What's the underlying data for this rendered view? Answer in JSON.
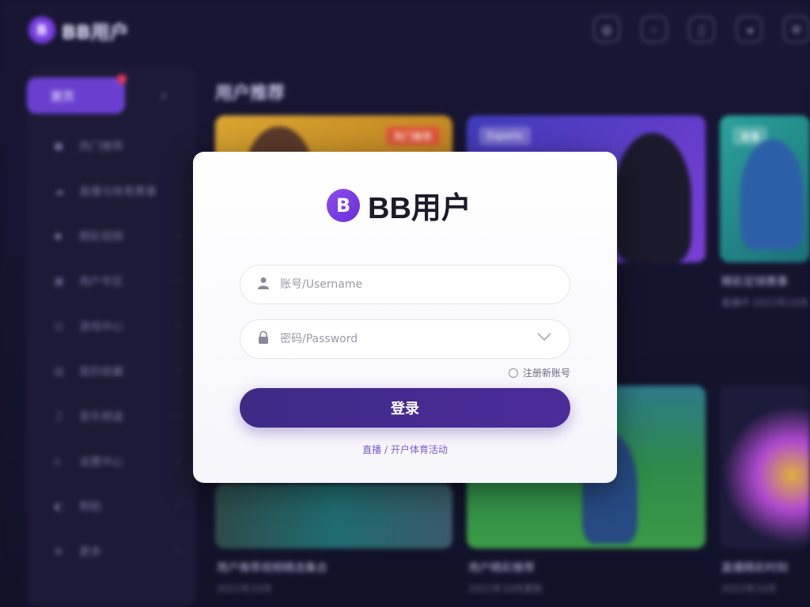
{
  "header": {
    "logo_letter": "B",
    "brand": "BB用户",
    "icons": [
      "globe-icon",
      "search-icon",
      "phone-icon",
      "bell-icon",
      "settings-icon"
    ]
  },
  "sidebar": {
    "active_label": "首页",
    "items": [
      {
        "icon": "●",
        "label": "热门推荐"
      },
      {
        "icon": "☁",
        "label": "直播与体育赛事"
      },
      {
        "icon": "◆",
        "label": "精彩视频"
      },
      {
        "icon": "▣",
        "label": "用户专区"
      },
      {
        "icon": "◎",
        "label": "游戏中心"
      },
      {
        "icon": "▤",
        "label": "我的收藏"
      },
      {
        "icon": "♫",
        "label": "音乐频道"
      },
      {
        "icon": "⌂",
        "label": "设置中心"
      },
      {
        "icon": "◐",
        "label": "帮助"
      },
      {
        "icon": "⊕",
        "label": "更多"
      }
    ]
  },
  "main": {
    "title": "用户推荐",
    "cards": [
      {
        "tag": "热门推荐",
        "caption": "",
        "sub": ""
      },
      {
        "tag": "Esports",
        "caption": "",
        "sub": ""
      },
      {
        "tag": "直播",
        "caption": "精彩足球赛事",
        "sub": "直播中 2022年10月"
      },
      {
        "tag": "",
        "caption": "用户推荐视频精选集合",
        "sub": "2022年10月"
      },
      {
        "tag": "",
        "caption": "用户精彩推荐",
        "sub": "2022年10月更新"
      },
      {
        "tag": "",
        "caption": "直播精彩时刻",
        "sub": "2022年10月"
      }
    ]
  },
  "modal": {
    "logo_letter": "B",
    "title": "BB用户",
    "username_placeholder": "账号/Username",
    "password_placeholder": "密码/Password",
    "register_label": "注册新账号",
    "login_label": "登录",
    "links": "直播 / 开户体育活动"
  },
  "colors": {
    "accent": "#6a3fd0",
    "button": "#4b2c9a",
    "background": "#14132a"
  }
}
